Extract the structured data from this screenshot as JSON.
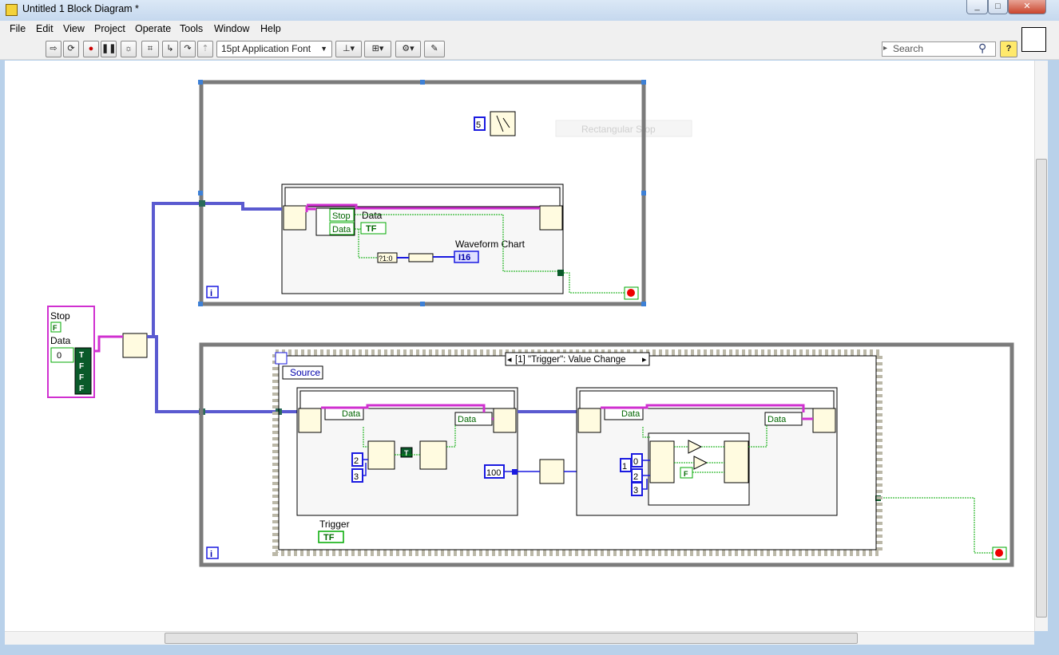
{
  "window": {
    "title": "Untitled 1 Block Diagram *"
  },
  "menu": [
    "File",
    "Edit",
    "View",
    "Project",
    "Operate",
    "Tools",
    "Window",
    "Help"
  ],
  "toolbar": {
    "font": "15pt Application Font"
  },
  "search": {
    "placeholder": "Search"
  },
  "diagram": {
    "floating_label": "Rectangular Stop",
    "top_loop": {
      "wait_const": "5",
      "cluster_stop": "Stop",
      "cluster_data": "Data",
      "data_label": "Data",
      "chart_label": "Waveform Chart",
      "bool_const": "TF",
      "num_ind": "I16",
      "convert": "?1:0",
      "iter": "i"
    },
    "cluster_const": {
      "stop": "Stop",
      "data": "Data",
      "stop_val": "F",
      "data_idx": "0",
      "bools": [
        "T",
        "F",
        "F",
        "F"
      ]
    },
    "bottom_loop": {
      "event_selector": "[1] \"Trigger\": Value Change",
      "source": "Source",
      "left_data_a": "Data",
      "left_data_b": "Data",
      "right_data_a": "Data",
      "right_data_b": "Data",
      "const_2a": "2",
      "const_3a": "3",
      "const_T": "T",
      "wait_ms": "100",
      "const_1": "1",
      "const_0": "0",
      "const_2b": "2",
      "const_3b": "3",
      "const_F": "F",
      "trigger_label": "Trigger",
      "trigger_term": "TF",
      "iter": "i"
    }
  }
}
